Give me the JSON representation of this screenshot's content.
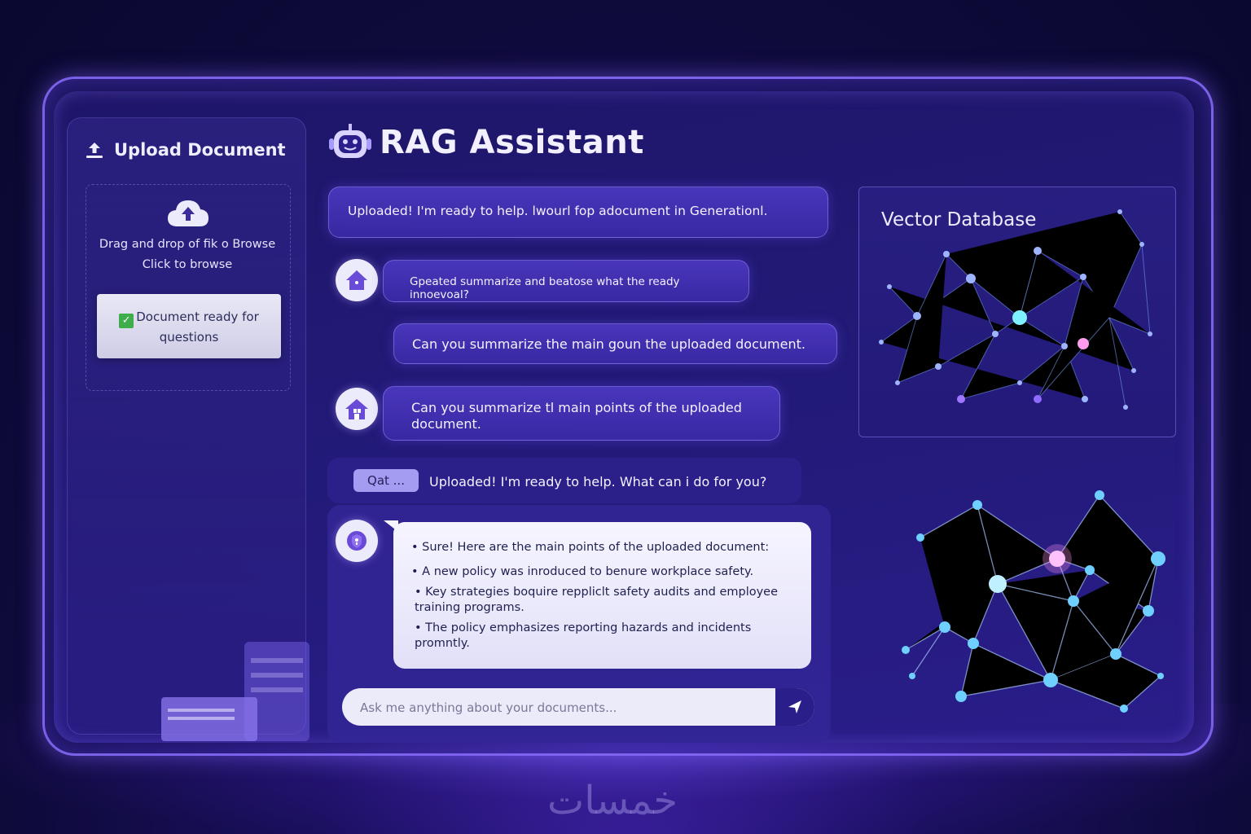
{
  "app": {
    "title": "RAG Assistant"
  },
  "sidebar": {
    "title": "Upload Document",
    "dropzone": {
      "line1": "Drag and drop of fik o Browse",
      "line2": "Click to browse"
    },
    "status": {
      "line1": "Document ready for",
      "line2": "questions",
      "color": "#3fae4a"
    }
  },
  "chat": {
    "messages": [
      {
        "text": "Uploaded! I'm ready to help. lwourl fop adocument in Generationl."
      },
      {
        "text": "Gpeated summarize and beatose what the ready innoevoal?"
      },
      {
        "text": "Can you summarize the main goun the uploaded document."
      },
      {
        "text": "Can you summarize tl main points of the uploaded document."
      },
      {
        "tag": "Qat ...",
        "text": "Uploaded! I'm ready to help. What can i do for you?"
      }
    ],
    "answer": {
      "intro": "• Sure! Here are the main points of the uploaded document:",
      "points": [
        "• A new policy was inroduced to benure workplace safety.",
        "• Key strategies boquire reppliclt safety audits and employee training programs.",
        "• The policy emphasizes reporting hazards and incidents promntly."
      ]
    },
    "input": {
      "placeholder": "Ask me anything about your documents..."
    }
  },
  "vector_db": {
    "title": "Vector Database"
  },
  "watermark": "خمسات",
  "colors": {
    "accent": "#8c6eff",
    "background": "#0e0a3a",
    "panel": "#221a78"
  }
}
